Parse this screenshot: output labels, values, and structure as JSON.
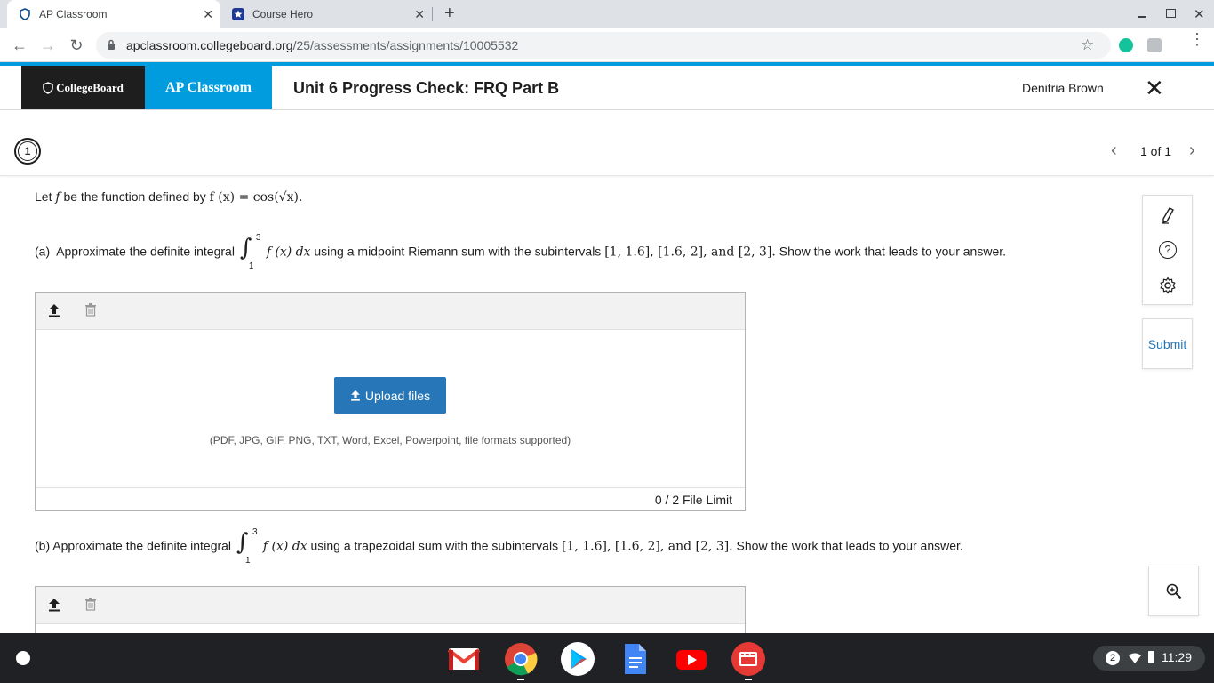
{
  "browser": {
    "tabs": [
      {
        "label": "AP Classroom",
        "active": true
      },
      {
        "label": "Course Hero",
        "active": false
      }
    ],
    "url_domain": "apclassroom.collegeboard.org",
    "url_path": "/25/assessments/assignments/10005532"
  },
  "header": {
    "cb_logo": "CollegeBoard",
    "ap_logo": "AP Classroom",
    "title": "Unit 6 Progress Check: FRQ Part B",
    "user": "Denitria Brown"
  },
  "question_nav": {
    "number": "1",
    "pager": "1 of 1"
  },
  "question": {
    "stem_prefix": "Let",
    "stem_var": "f",
    "stem_middle": "be the function defined by",
    "stem_formula": "f (x) = cos(√x).",
    "part_a": {
      "label": "(a)",
      "text_before": "Approximate the definite integral",
      "integrand": "f (x) dx",
      "text_after": "using a midpoint Riemann sum with the subintervals",
      "intervals": "[1, 1.6], [1.6, 2], and [2, 3].",
      "tail": "Show the work that leads to your answer."
    },
    "part_b": {
      "label": "(b)",
      "text_before": "Approximate the definite integral",
      "integrand": "f (x) dx",
      "text_after": "using a trapezoidal sum with the subintervals",
      "intervals": "[1, 1.6], [1.6, 2], and [2, 3].",
      "tail": "Show the work that leads to your answer."
    },
    "integral_upper": "3",
    "integral_lower": "1"
  },
  "upload": {
    "button_label": "Upload files",
    "formats": "(PDF, JPG, GIF, PNG, TXT, Word, Excel, Powerpoint, file formats supported)",
    "file_limit": "0 / 2 File Limit"
  },
  "sidebar": {
    "submit_label": "Submit"
  },
  "shelf": {
    "notifications": "2",
    "time": "11:29"
  },
  "colors": {
    "accent": "#009cde",
    "button": "#2777b8",
    "cb_black": "#1e1e1e"
  }
}
